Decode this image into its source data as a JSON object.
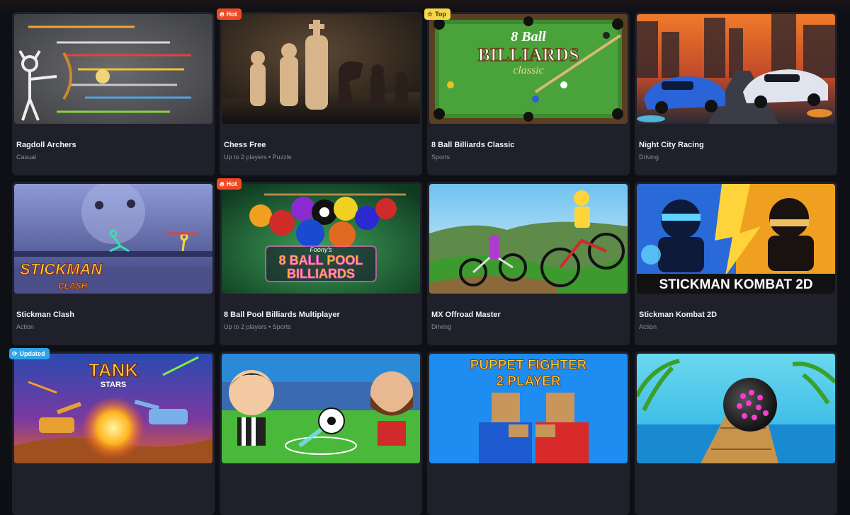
{
  "games": [
    {
      "title": "Ragdoll Archers",
      "meta": "Casual",
      "badge": null
    },
    {
      "title": "Chess Free",
      "meta": "Up to 2 players • Puzzle",
      "badge": {
        "label": "Hot",
        "kind": "hot",
        "icon": "flame-icon"
      }
    },
    {
      "title": "8 Ball Billiards Classic",
      "meta": "Sports",
      "badge": {
        "label": "Top",
        "kind": "top",
        "icon": "star-icon"
      }
    },
    {
      "title": "Night City Racing",
      "meta": "Driving",
      "badge": null
    },
    {
      "title": "Stickman Clash",
      "meta": "Action",
      "badge": null
    },
    {
      "title": "8 Ball Pool Billiards Multiplayer",
      "meta": "Up to 2 players • Sports",
      "badge": {
        "label": "Hot",
        "kind": "hot",
        "icon": "flame-icon"
      }
    },
    {
      "title": "MX Offroad Master",
      "meta": "Driving",
      "badge": null
    },
    {
      "title": "Stickman Kombat 2D",
      "meta": "Action",
      "badge": null
    },
    {
      "title": "",
      "meta": "",
      "badge": {
        "label": "Updated",
        "kind": "updated",
        "icon": "refresh-icon"
      }
    },
    {
      "title": "",
      "meta": "",
      "badge": null
    },
    {
      "title": "",
      "meta": "",
      "badge": null
    },
    {
      "title": "",
      "meta": "",
      "badge": null
    }
  ],
  "thumb_text": {
    "billiards_classic_line1": "8 Ball",
    "billiards_classic_line2": "BILLIARDS",
    "billiards_classic_line3": "classic",
    "stickman_clash_line1": "STICKMAN",
    "stickman_clash_line2": "CLASH",
    "pool_brand": "Foony's",
    "pool_line1": "8 BALL POOL",
    "pool_line2": "BILLIARDS",
    "kombat_banner": "STICKMAN KOMBAT 2D",
    "tank_line1": "TANK",
    "tank_line2": "STARS",
    "puppet_line1": "PUPPET FIGHTER",
    "puppet_line2": "2 PLAYER"
  },
  "colors": {
    "hot_badge": "#ef4a24",
    "top_badge": "#f7d84b",
    "updated_badge": "#2fa3e6",
    "card_bg": "#1f2029"
  }
}
